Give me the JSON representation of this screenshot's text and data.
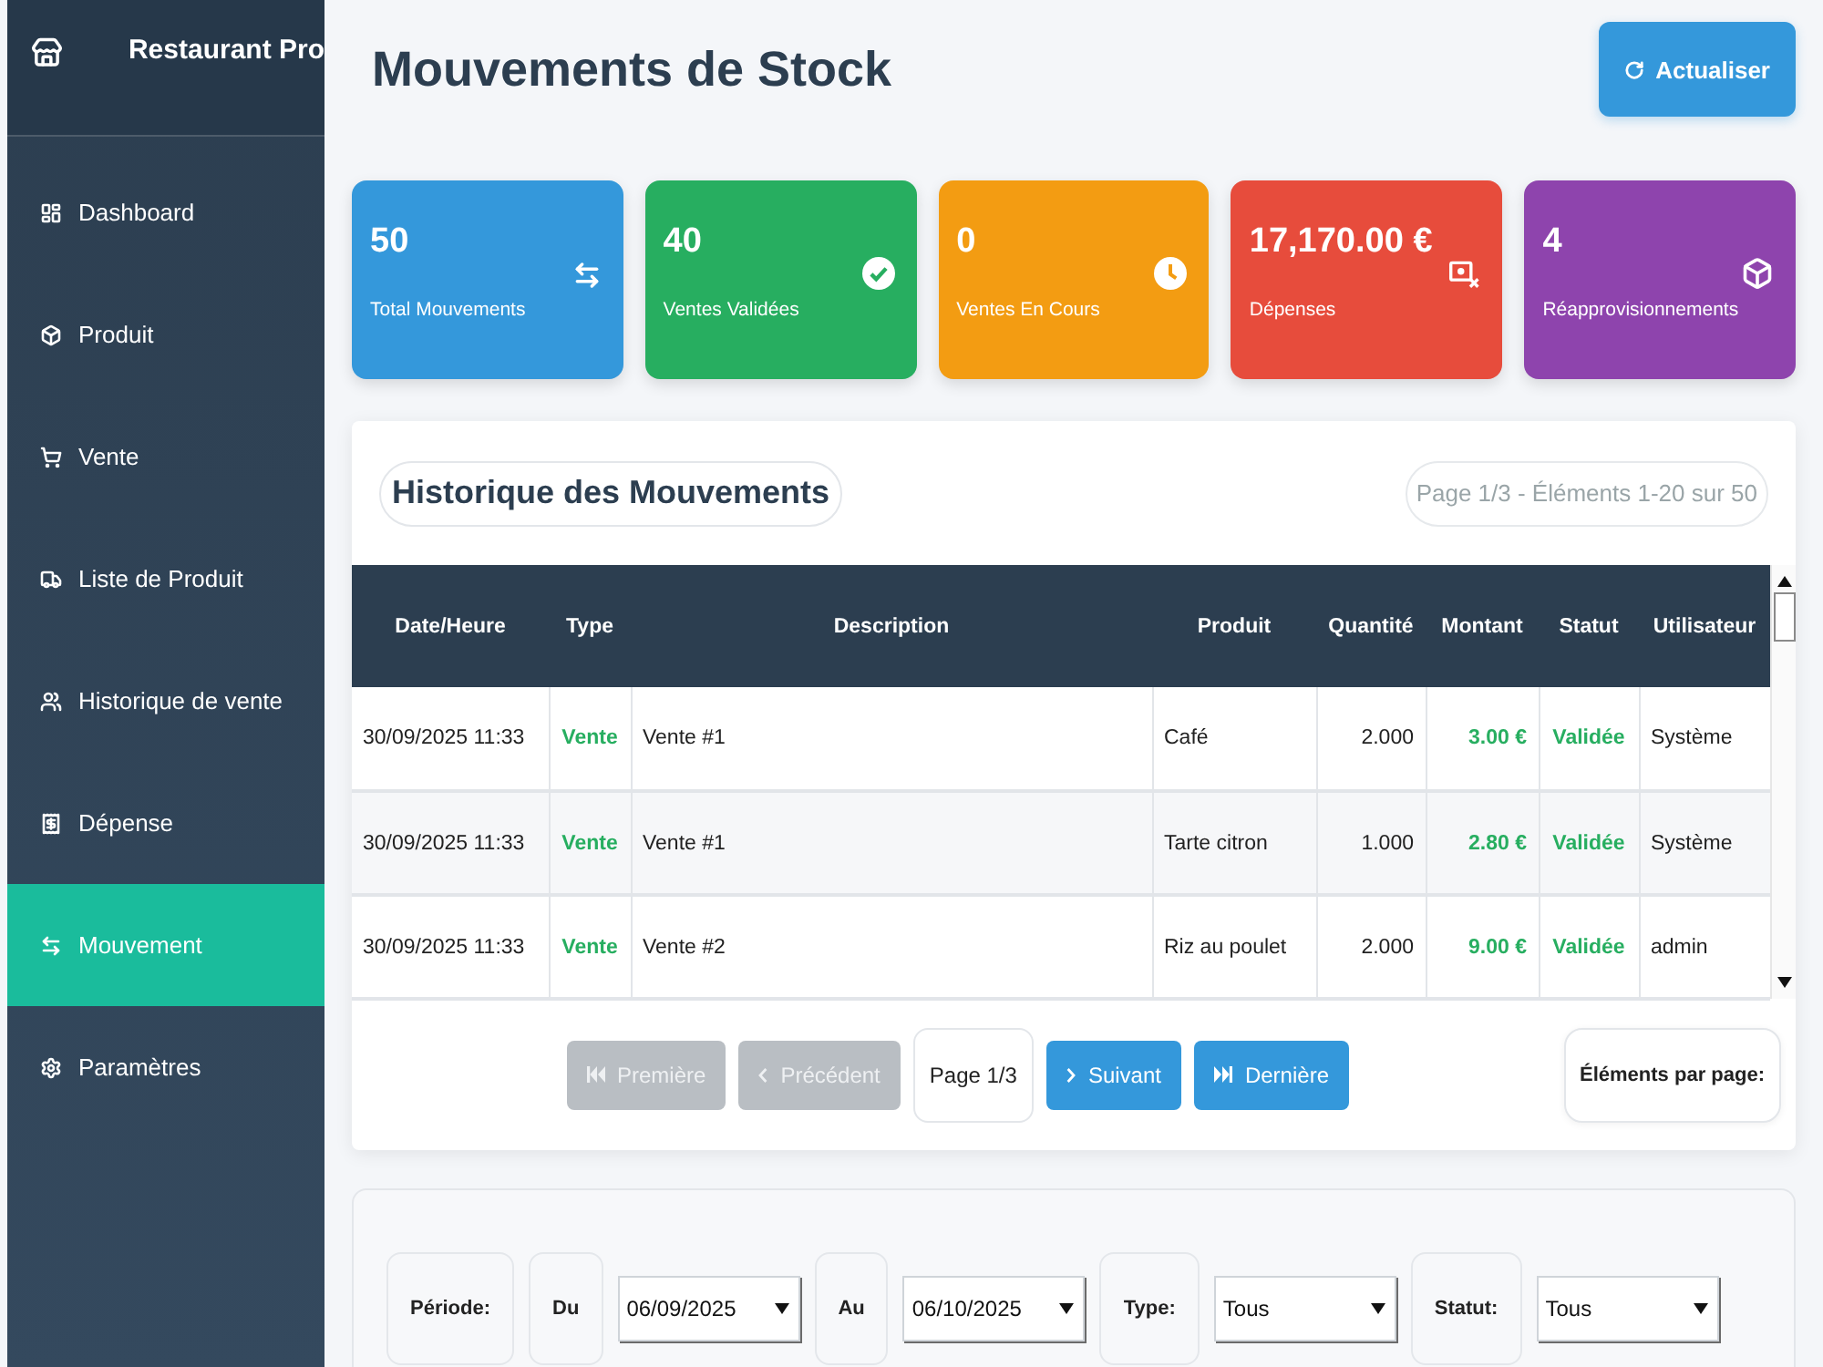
{
  "sidebar": {
    "title": "Restaurant Pro",
    "items": [
      {
        "label": "Dashboard",
        "selected": false
      },
      {
        "label": "Produit",
        "selected": false
      },
      {
        "label": "Vente",
        "selected": false
      },
      {
        "label": "Liste de Produit",
        "selected": false
      },
      {
        "label": "Historique de vente",
        "selected": false
      },
      {
        "label": "Dépense",
        "selected": false
      },
      {
        "label": "Mouvement",
        "selected": true
      },
      {
        "label": "Paramètres",
        "selected": false
      }
    ]
  },
  "header": {
    "title": "Mouvements de Stock",
    "refresh_button": "Actualiser"
  },
  "stats": [
    {
      "value": "50",
      "label": "Total Mouvements",
      "color": "#3498db"
    },
    {
      "value": "40",
      "label": "Ventes Validées",
      "color": "#27ae60"
    },
    {
      "value": "0",
      "label": "Ventes En Cours",
      "color": "#f39c12"
    },
    {
      "value": "17,170.00 €",
      "label": "Dépenses",
      "color": "#e74c3c"
    },
    {
      "value": "4",
      "label": "Réapprovisionnements",
      "color": "#8e44ad"
    }
  ],
  "history": {
    "title": "Historique des Mouvements",
    "page_info": "Page 1/3 - Éléments 1-20 sur 50",
    "table": {
      "columns": [
        "Date/Heure",
        "Type",
        "Description",
        "Produit",
        "Quantité",
        "Montant",
        "Statut",
        "Utilisateur"
      ],
      "rows": [
        [
          "30/09/2025 11:33",
          "Vente",
          "Vente #1",
          "Café",
          "2.000",
          "3.00 €",
          "Validée",
          "Système"
        ],
        [
          "30/09/2025 11:33",
          "Vente",
          "Vente #1",
          "Tarte citron",
          "1.000",
          "2.80 €",
          "Validée",
          "Système"
        ],
        [
          "30/09/2025 11:33",
          "Vente",
          "Vente #2",
          "Riz au poulet",
          "2.000",
          "9.00 €",
          "Validée",
          "admin"
        ]
      ]
    },
    "pagination": [
      {
        "kind": "button",
        "label": "Première",
        "disabled": true
      },
      {
        "kind": "button",
        "label": "Précédent",
        "disabled": true
      },
      {
        "kind": "indicator",
        "label": "Page 1/3"
      },
      {
        "kind": "button",
        "label": "Suivant",
        "disabled": false
      },
      {
        "kind": "button",
        "label": "Dernière",
        "disabled": false
      }
    ],
    "page_size_label": "Éléments par page:"
  },
  "filters": [
    {
      "kind": "label",
      "text": "Période:"
    },
    {
      "kind": "label",
      "text": "Du"
    },
    {
      "kind": "select",
      "value": "06/09/2025"
    },
    {
      "kind": "label",
      "text": "Au"
    },
    {
      "kind": "select",
      "value": "06/10/2025"
    },
    {
      "kind": "label",
      "text": "Type:"
    },
    {
      "kind": "select",
      "value": "Tous"
    },
    {
      "kind": "label",
      "text": "Statut:"
    },
    {
      "kind": "select",
      "value": "Tous"
    }
  ]
}
